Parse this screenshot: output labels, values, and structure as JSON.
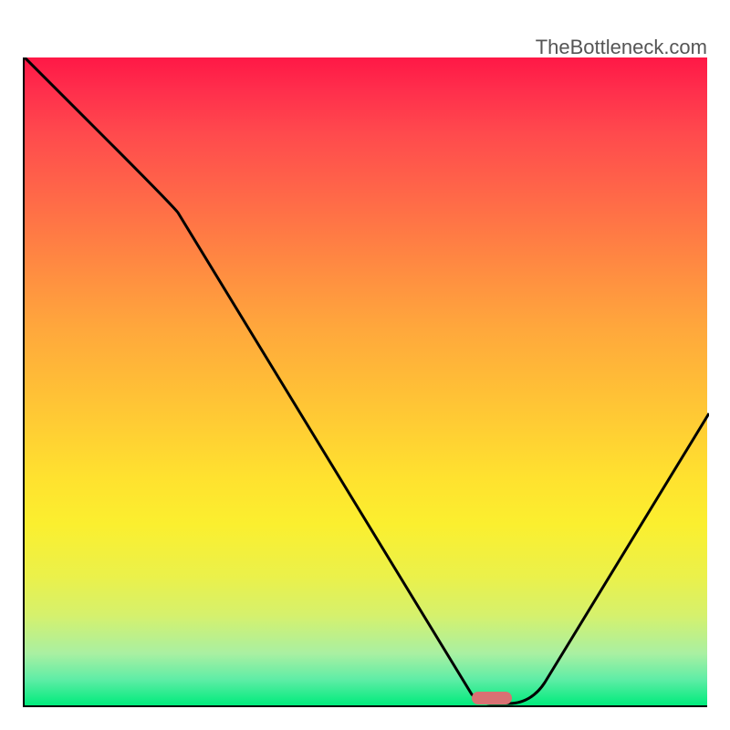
{
  "watermark": "TheBottleneck.com",
  "chart_data": {
    "type": "line",
    "title": "",
    "xlabel": "",
    "ylabel": "",
    "xlim": [
      0,
      100
    ],
    "ylim": [
      0,
      100
    ],
    "series": [
      {
        "name": "curve",
        "x": [
          0,
          10,
          22,
          65,
          70,
          75,
          100
        ],
        "y": [
          100,
          90,
          78,
          2,
          0.5,
          0.5,
          45
        ]
      }
    ],
    "gradient": {
      "stops": [
        {
          "pos": 0,
          "color": "#ff1846"
        },
        {
          "pos": 50,
          "color": "#ffbc37"
        },
        {
          "pos": 80,
          "color": "#ebf14a"
        },
        {
          "pos": 100,
          "color": "#00eb7c"
        }
      ]
    },
    "marker": {
      "x_center": 68,
      "width": 6,
      "y": 0.8,
      "color": "#d97173"
    },
    "axes_visible": false,
    "grid": false
  }
}
